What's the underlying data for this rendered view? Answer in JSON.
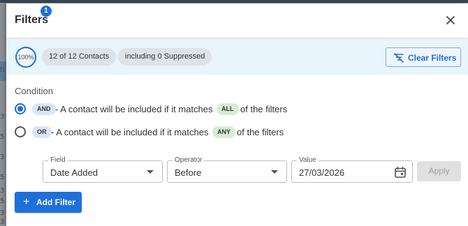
{
  "background": {
    "row_fragments": [
      "3",
      "5",
      "3",
      "5",
      "3",
      "5",
      "3",
      "3"
    ],
    "tab_fragment": "ti"
  },
  "dialog": {
    "title": "Filters",
    "filter_count_badge": "1",
    "close_icon": "close-icon"
  },
  "summary": {
    "percent": "100%",
    "contacts_chip": "12 of 12 Contacts",
    "suppressed_chip": "including 0 Suppressed",
    "clear_filters_label": "Clear Filters",
    "clear_filters_icon": "filter-off-icon"
  },
  "condition": {
    "label": "Condition",
    "selected": "AND",
    "options": [
      {
        "tag": "AND",
        "text_before": "- A contact will be included if it matches",
        "match_tag": "ALL",
        "text_after": "of the filters"
      },
      {
        "tag": "OR",
        "text_before": "- A contact will be included if it matches",
        "match_tag": "ANY",
        "text_after": "of the filters"
      }
    ]
  },
  "filter_row": {
    "field": {
      "label": "Field",
      "value": "Date Added"
    },
    "operator": {
      "label": "Operator",
      "value": "Before"
    },
    "value": {
      "label": "Value",
      "value": "27/03/2026",
      "icon": "calendar-icon"
    },
    "apply_label": "Apply"
  },
  "add_filter_label": "Add Filter",
  "colors": {
    "accent": "#1e6fd9",
    "summary_bg": "#e8f5fc",
    "chip_bg": "#dde3e8",
    "tag_blue": "#d8e6f7",
    "tag_green": "#d7ecd2"
  }
}
